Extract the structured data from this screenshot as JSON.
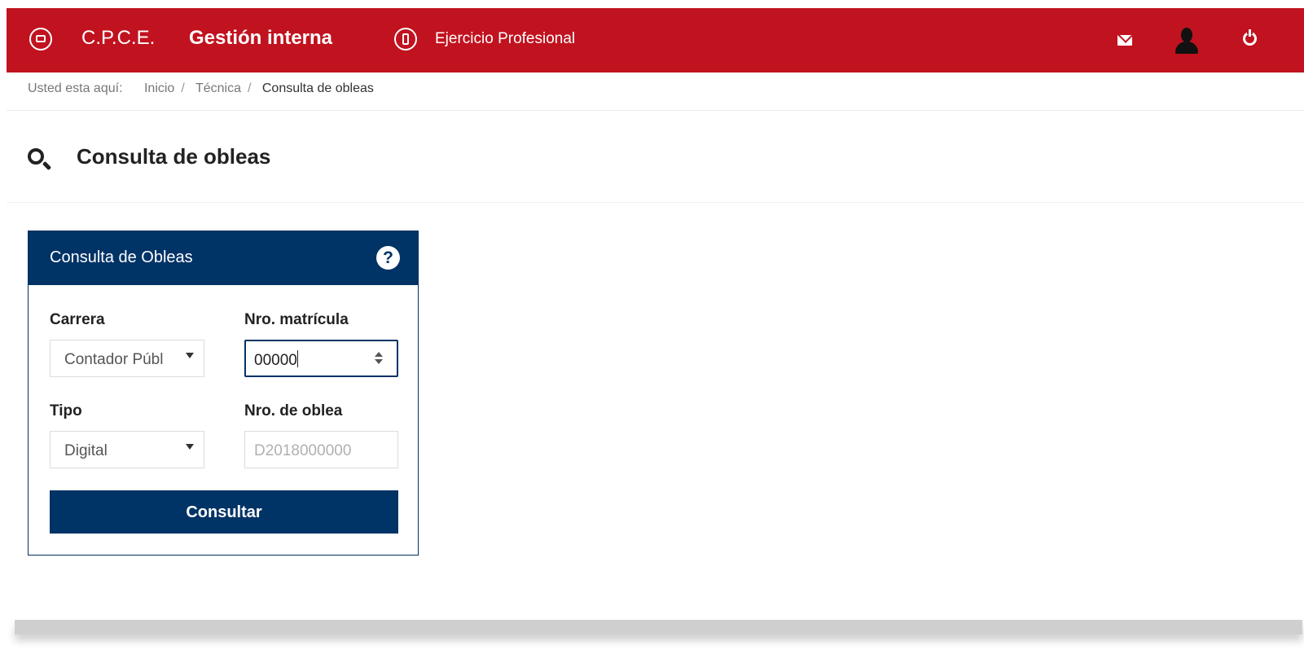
{
  "header": {
    "org_name": "C.P.C.E.",
    "app_name": "Gestión interna",
    "module_label": "Ejercicio Profesional",
    "icons": [
      "brand-icon",
      "module-icon",
      "mail-icon",
      "user-icon",
      "power-icon"
    ],
    "color": "#c1121f"
  },
  "breadcrumb": {
    "lead": "Usted esta aquí:",
    "items": [
      "Inicio",
      "Técnica",
      "Consulta de obleas"
    ],
    "separator": "/"
  },
  "page": {
    "title": "Consulta de obleas",
    "icon": "search-icon"
  },
  "panel": {
    "title": "Consulta de Obleas",
    "help_icon": "?",
    "color": "#003366",
    "fields": {
      "carrera": {
        "label": "Carrera",
        "value": "Contador Públ"
      },
      "matricula": {
        "label": "Nro. matrícula",
        "value": "00000"
      },
      "tipo": {
        "label": "Tipo",
        "value": "Digital"
      },
      "oblea": {
        "label": "Nro. de oblea",
        "placeholder": "D2018000000"
      }
    },
    "submit_label": "Consultar"
  }
}
